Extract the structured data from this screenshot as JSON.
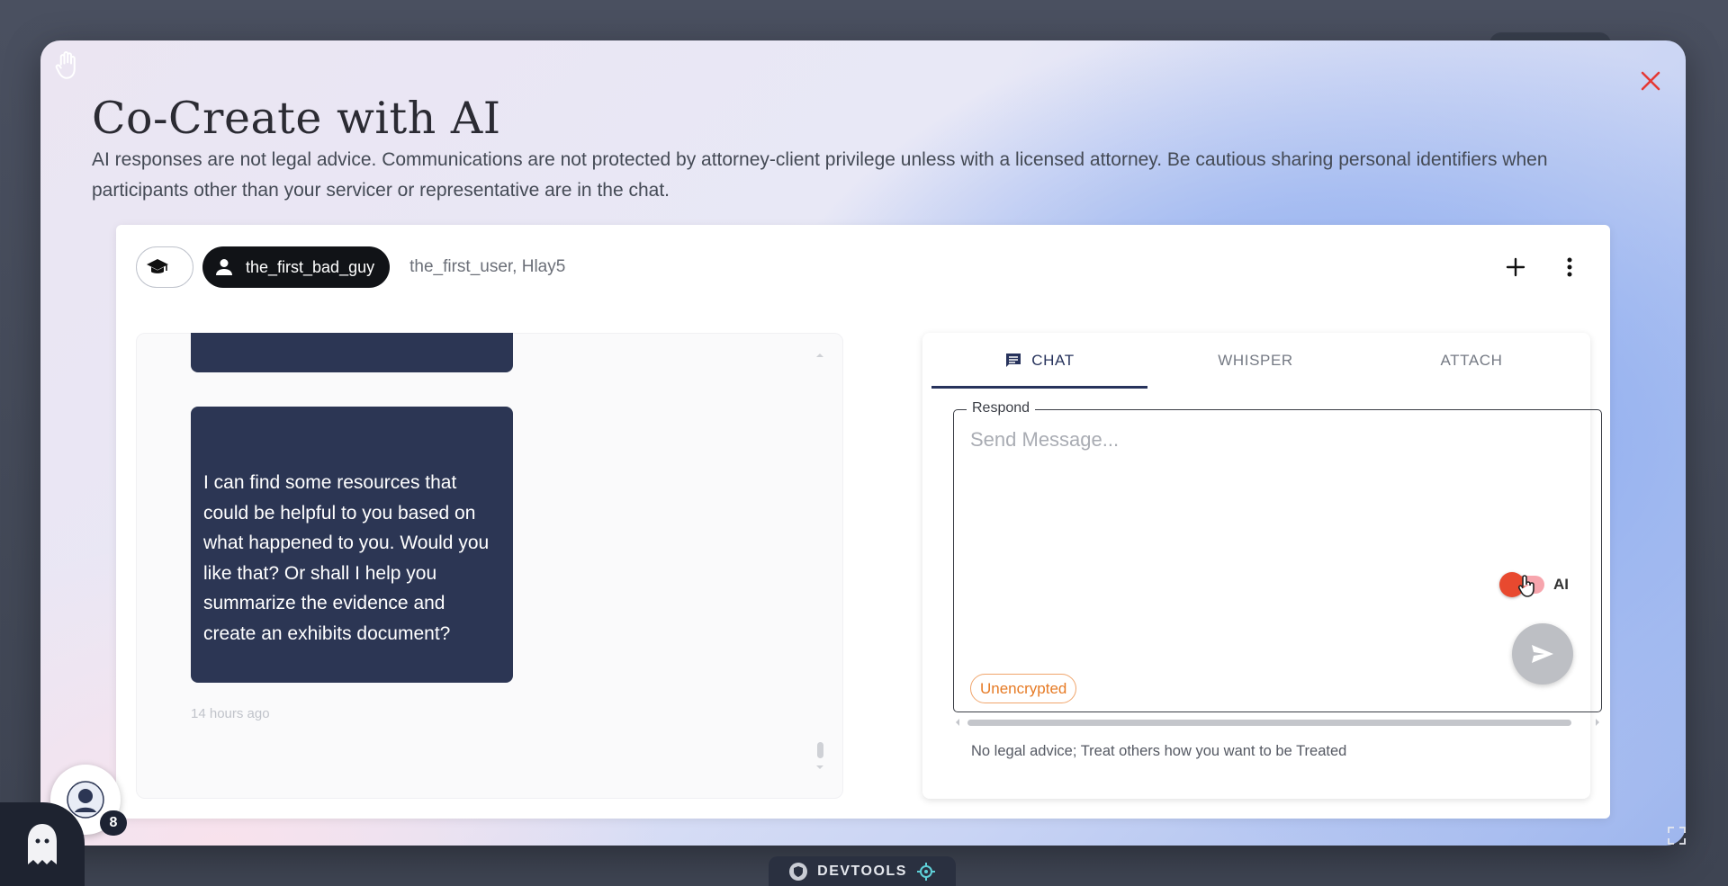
{
  "modal": {
    "title": "Co-Create with AI",
    "disclaimer": "AI responses are not legal advice. Communications are not protected by attorney-client privilege unless with a licensed attorney. Be cautious sharing personal identifiers when participants other than your servicer or representative are in the chat."
  },
  "header": {
    "user_chip": "the_first_bad_guy",
    "participants": "the_first_user, Hlay5"
  },
  "chat_history": {
    "message": "I can find some resources that could be helpful to you based on what happened to you. Would you like that? Or shall I help you summarize the evidence and create an exhibits document?",
    "timestamp": "14 hours ago"
  },
  "tabs": [
    {
      "label": "CHAT",
      "active": true
    },
    {
      "label": "WHISPER",
      "active": false
    },
    {
      "label": "ATTACH",
      "active": false
    }
  ],
  "composer": {
    "label": "Respond",
    "placeholder": "Send Message...",
    "ai_toggle_label": "AI",
    "ai_enabled": true,
    "encryption_badge": "Unencrypted",
    "footer_note": "No legal advice; Treat others how you want to be Treated"
  },
  "overlays": {
    "notification_count": "8",
    "devtools_label": "DEVTOOLS"
  },
  "colors": {
    "bubble": "#2c3654",
    "accent": "#27335c",
    "close": "#e53935",
    "toggle_on": "#e8492f",
    "badge_orange": "#e67a24"
  }
}
